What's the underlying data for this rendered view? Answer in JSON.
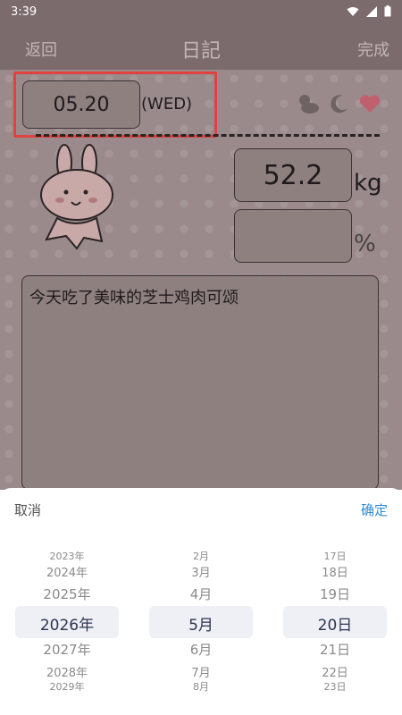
{
  "status_bar": {
    "time": "3:39"
  },
  "header": {
    "back_label": "返回",
    "title": "日記",
    "done_label": "完成"
  },
  "entry": {
    "date": "05.20",
    "weekday": "(WED)",
    "weight_value": "52.2",
    "weight_unit": "kg",
    "fat_unit": "%",
    "note_text": "今天吃了美味的芝士鸡肉可颂"
  },
  "picker": {
    "cancel_label": "取消",
    "confirm_label": "确定",
    "years": [
      "2023年",
      "2024年",
      "2025年",
      "2026年",
      "2027年",
      "2028年",
      "2029年"
    ],
    "months": [
      "2月",
      "3月",
      "4月",
      "5月",
      "6月",
      "7月",
      "8月"
    ],
    "days": [
      "17日",
      "18日",
      "19日",
      "20日",
      "21日",
      "22日",
      "23日"
    ],
    "selected_year": "2026年",
    "selected_month": "5月",
    "selected_day": "20日"
  },
  "colors": {
    "accent_blue": "#2f8bd6",
    "highlight_red": "#e04242",
    "header_bg": "#7c6b6c"
  }
}
